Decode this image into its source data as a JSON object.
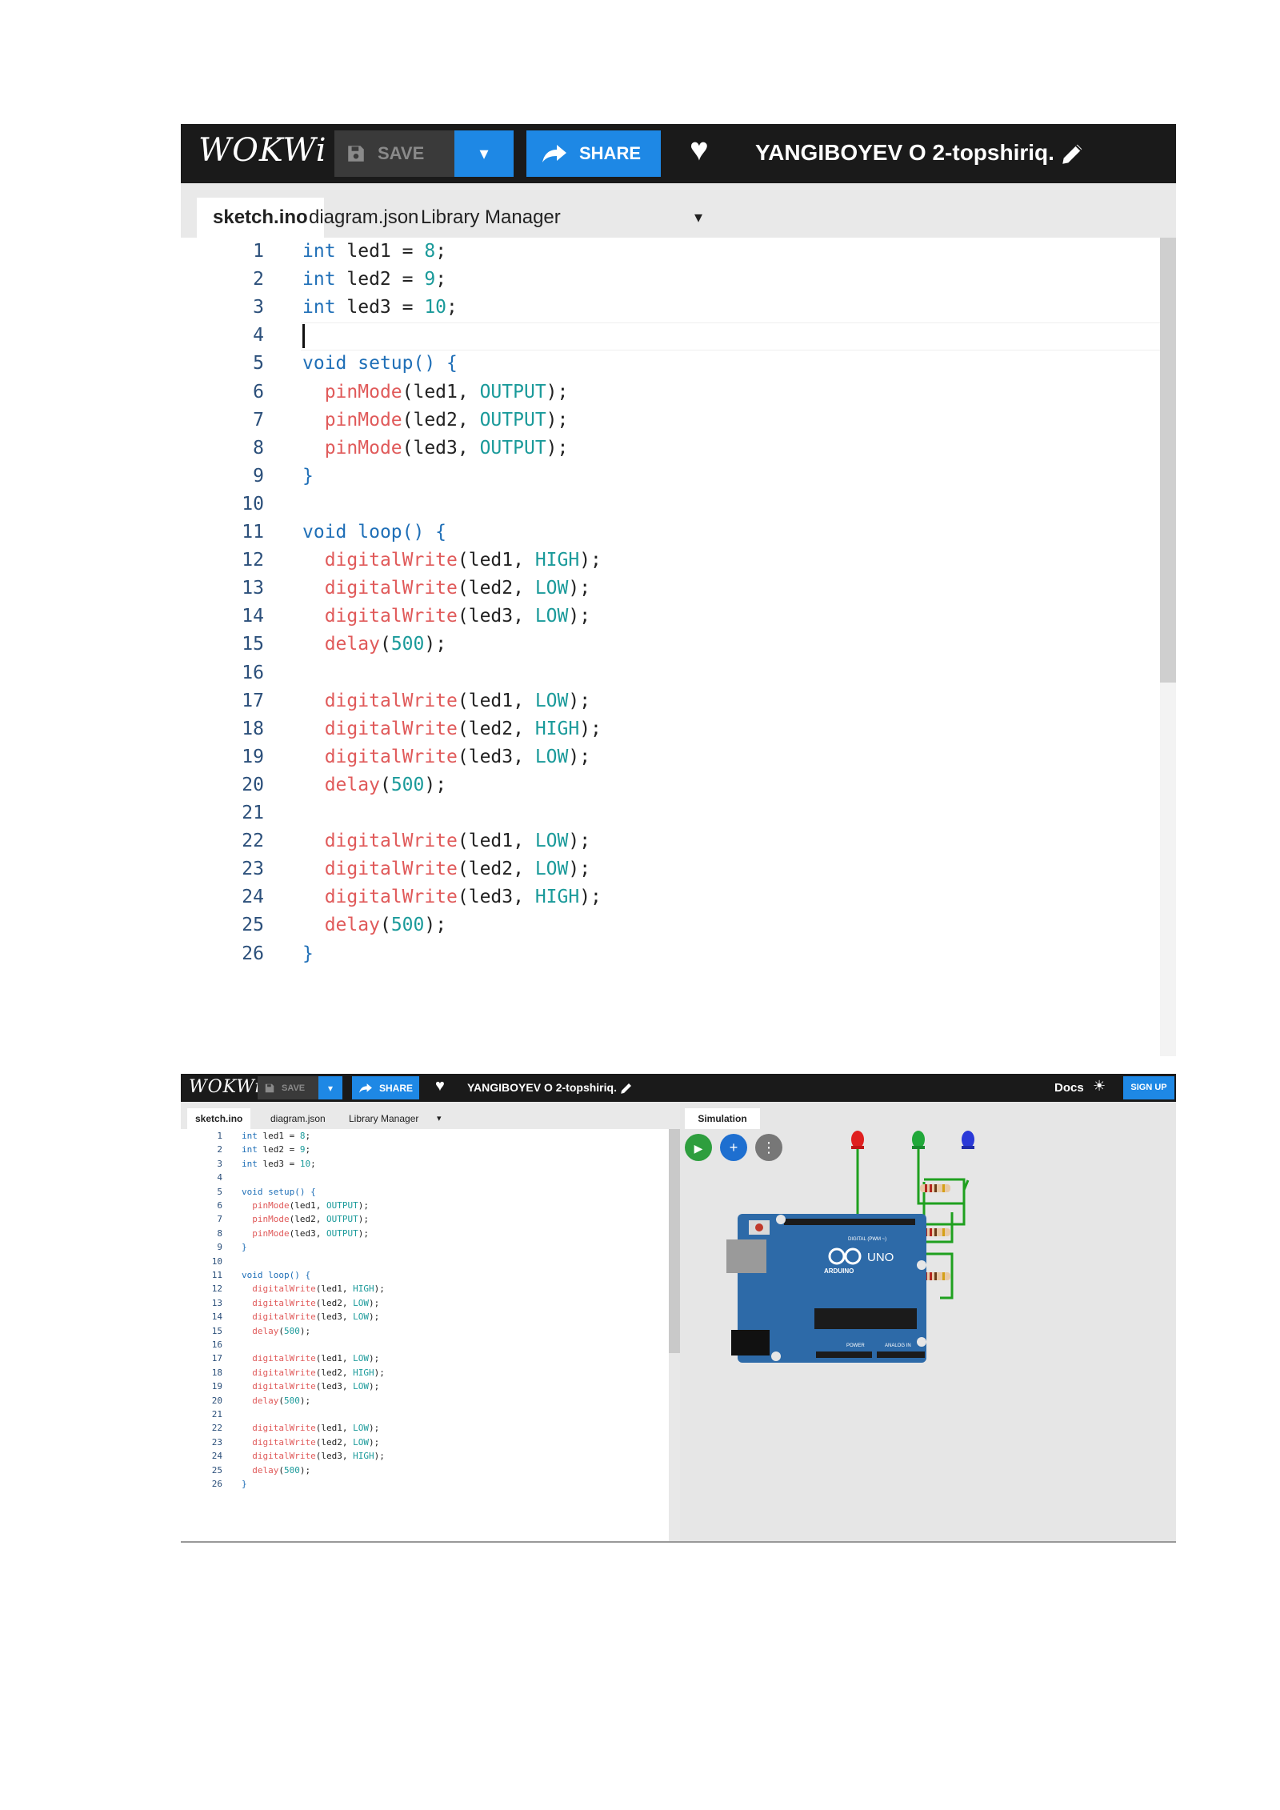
{
  "app": {
    "logo": "WOKWi",
    "save_label": "SAVE",
    "dropdown_glyph": "▾",
    "share_label": "SHARE",
    "project_title": "YANGIBOYEV O 2-topshiriq.",
    "docs_label": "Docs",
    "signup_label": "SIGN UP"
  },
  "tabs": [
    {
      "label": "sketch.ino",
      "active": true
    },
    {
      "label": "diagram.json",
      "active": false
    },
    {
      "label": "Library Manager",
      "active": false
    }
  ],
  "tabs_more_glyph": "▾",
  "simulation": {
    "tab_label": "Simulation",
    "play_glyph": "▶",
    "add_glyph": "+",
    "more_glyph": "⋮",
    "board_name": "UNO",
    "board_brand": "ARDUINO",
    "digital_label": "DIGITAL (PWM ~)",
    "power_label": "POWER",
    "analog_label": "ANALOG IN",
    "led_colors": [
      "#e02020",
      "#21a83a",
      "#2a39d8"
    ],
    "wire_color": "#1fa01f",
    "board_color": "#2d6aa8"
  },
  "code_lines": [
    [
      [
        "kw",
        "int"
      ],
      [
        "t",
        " led1 = "
      ],
      [
        "num",
        "8"
      ],
      [
        "t",
        ";"
      ]
    ],
    [
      [
        "kw",
        "int"
      ],
      [
        "t",
        " led2 = "
      ],
      [
        "num",
        "9"
      ],
      [
        "t",
        ";"
      ]
    ],
    [
      [
        "kw",
        "int"
      ],
      [
        "t",
        " led3 = "
      ],
      [
        "num",
        "10"
      ],
      [
        "t",
        ";"
      ]
    ],
    [],
    [
      [
        "kw",
        "void"
      ],
      [
        "t",
        " "
      ],
      [
        "kw",
        "setup() {"
      ]
    ],
    [
      [
        "t",
        "  "
      ],
      [
        "fn",
        "pinMode"
      ],
      [
        "t",
        "(led1, "
      ],
      [
        "cn",
        "OUTPUT"
      ],
      [
        "t",
        ");"
      ]
    ],
    [
      [
        "t",
        "  "
      ],
      [
        "fn",
        "pinMode"
      ],
      [
        "t",
        "(led2, "
      ],
      [
        "cn",
        "OUTPUT"
      ],
      [
        "t",
        ");"
      ]
    ],
    [
      [
        "t",
        "  "
      ],
      [
        "fn",
        "pinMode"
      ],
      [
        "t",
        "(led3, "
      ],
      [
        "cn",
        "OUTPUT"
      ],
      [
        "t",
        ");"
      ]
    ],
    [
      [
        "br",
        "}"
      ]
    ],
    [],
    [
      [
        "kw",
        "void"
      ],
      [
        "t",
        " "
      ],
      [
        "kw",
        "loop() {"
      ]
    ],
    [
      [
        "t",
        "  "
      ],
      [
        "fn",
        "digitalWrite"
      ],
      [
        "t",
        "(led1, "
      ],
      [
        "cn",
        "HIGH"
      ],
      [
        "t",
        ");"
      ]
    ],
    [
      [
        "t",
        "  "
      ],
      [
        "fn",
        "digitalWrite"
      ],
      [
        "t",
        "(led2, "
      ],
      [
        "cn",
        "LOW"
      ],
      [
        "t",
        ");"
      ]
    ],
    [
      [
        "t",
        "  "
      ],
      [
        "fn",
        "digitalWrite"
      ],
      [
        "t",
        "(led3, "
      ],
      [
        "cn",
        "LOW"
      ],
      [
        "t",
        ");"
      ]
    ],
    [
      [
        "t",
        "  "
      ],
      [
        "fn",
        "delay"
      ],
      [
        "t",
        "("
      ],
      [
        "num",
        "500"
      ],
      [
        "t",
        ");"
      ]
    ],
    [],
    [
      [
        "t",
        "  "
      ],
      [
        "fn",
        "digitalWrite"
      ],
      [
        "t",
        "(led1, "
      ],
      [
        "cn",
        "LOW"
      ],
      [
        "t",
        ");"
      ]
    ],
    [
      [
        "t",
        "  "
      ],
      [
        "fn",
        "digitalWrite"
      ],
      [
        "t",
        "(led2, "
      ],
      [
        "cn",
        "HIGH"
      ],
      [
        "t",
        ");"
      ]
    ],
    [
      [
        "t",
        "  "
      ],
      [
        "fn",
        "digitalWrite"
      ],
      [
        "t",
        "(led3, "
      ],
      [
        "cn",
        "LOW"
      ],
      [
        "t",
        ");"
      ]
    ],
    [
      [
        "t",
        "  "
      ],
      [
        "fn",
        "delay"
      ],
      [
        "t",
        "("
      ],
      [
        "num",
        "500"
      ],
      [
        "t",
        ");"
      ]
    ],
    [],
    [
      [
        "t",
        "  "
      ],
      [
        "fn",
        "digitalWrite"
      ],
      [
        "t",
        "(led1, "
      ],
      [
        "cn",
        "LOW"
      ],
      [
        "t",
        ");"
      ]
    ],
    [
      [
        "t",
        "  "
      ],
      [
        "fn",
        "digitalWrite"
      ],
      [
        "t",
        "(led2, "
      ],
      [
        "cn",
        "LOW"
      ],
      [
        "t",
        ");"
      ]
    ],
    [
      [
        "t",
        "  "
      ],
      [
        "fn",
        "digitalWrite"
      ],
      [
        "t",
        "(led3, "
      ],
      [
        "cn",
        "HIGH"
      ],
      [
        "t",
        ");"
      ]
    ],
    [
      [
        "t",
        "  "
      ],
      [
        "fn",
        "delay"
      ],
      [
        "t",
        "("
      ],
      [
        "num",
        "500"
      ],
      [
        "t",
        ");"
      ]
    ],
    [
      [
        "br",
        "}"
      ]
    ]
  ],
  "cursor_line": 4
}
